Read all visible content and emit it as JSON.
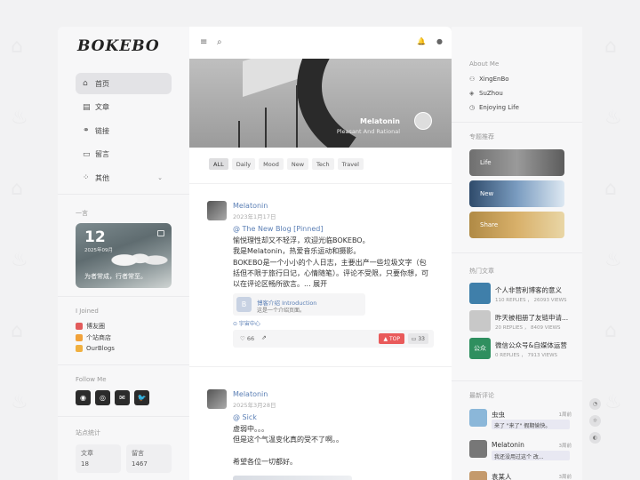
{
  "app": {
    "logo": "BOKEBO"
  },
  "nav": [
    {
      "icon": "home-icon",
      "glyph": "⌂",
      "label": "首页",
      "active": true
    },
    {
      "icon": "article-icon",
      "glyph": "▤",
      "label": "文章"
    },
    {
      "icon": "link-icon",
      "glyph": "⚭",
      "label": "链接"
    },
    {
      "icon": "message-icon",
      "glyph": "▭",
      "label": "留言"
    },
    {
      "icon": "grid-icon",
      "glyph": "⁘",
      "label": "其他",
      "chevron": "⌄"
    }
  ],
  "quote": {
    "section": "一言",
    "day": "12",
    "date": "2025年09月",
    "text": "为者常成，行者常至。"
  },
  "joined": {
    "section": "I Joined",
    "items": [
      {
        "label": "博友圈",
        "color": "#e25b5b"
      },
      {
        "label": "个站商店",
        "color": "#f1a23a"
      },
      {
        "label": "OurBlogs",
        "color": "#f0b040"
      }
    ]
  },
  "follow": {
    "section": "Follow Me",
    "icons": [
      {
        "name": "qq-icon",
        "glyph": "◉"
      },
      {
        "name": "wechat-icon",
        "glyph": "◎"
      },
      {
        "name": "mail-icon",
        "glyph": "✉"
      },
      {
        "name": "twitter-icon",
        "glyph": "🐦"
      }
    ]
  },
  "site_stats": {
    "section": "站点统计",
    "items": [
      {
        "label": "文章",
        "value": "18"
      },
      {
        "label": "留言",
        "value": "1467"
      }
    ]
  },
  "topbar": {
    "menu": "≡",
    "search": "⌕",
    "bell": "🔔",
    "user": "●"
  },
  "banner": {
    "title": "Melatonin",
    "subtitle": "Pleasant And Rational"
  },
  "tags": [
    {
      "label": "ALL",
      "active": true
    },
    {
      "label": "Daily"
    },
    {
      "label": "Mood"
    },
    {
      "label": "New"
    },
    {
      "label": "Tech"
    },
    {
      "label": "Travel"
    }
  ],
  "posts": [
    {
      "author": "Melatonin",
      "date": "2023年1月17日",
      "category": "@ The New Blog [Pinned]",
      "body": [
        "愉悦理性却又不轻浮，欢迎光临BOKEBO。",
        "我是Melatonin，热爱音乐运动和摄影。",
        "BOKEBO是一个小小的个人日志，主要出产一些垃圾文字（包",
        "括但不限于旅行日记，心情随笔）。评论不受限，只要你想，可",
        "以在评论区畅所欲言。... 展开"
      ],
      "link_card": {
        "title": "博客介绍 Introduction",
        "desc": "这是一个介绍页面。",
        "glyph": "B"
      },
      "location": "⊙ 宇宙中心",
      "likes": "♡ 66",
      "share": "⇗",
      "top_label": "▲ TOP",
      "comments": "▭ 33"
    },
    {
      "author": "Melatonin",
      "date": "2025年3月28日",
      "category": "@ Sick",
      "body": [
        "虚弱中。。。",
        "但是这个气温变化真的受不了啊。。",
        "",
        "希望各位一切都好。"
      ]
    }
  ],
  "about": {
    "section": "About Me",
    "items": [
      {
        "icon": "user-icon",
        "glyph": "⚇",
        "label": "XingEnBo"
      },
      {
        "icon": "location-icon",
        "glyph": "◈",
        "label": "SuZhou"
      },
      {
        "icon": "clock-icon",
        "glyph": "◷",
        "label": "Enjoying Life"
      }
    ]
  },
  "topics": {
    "section": "专题推荐",
    "items": [
      {
        "label": "Life",
        "bg": "linear-gradient(90deg,#6f6f6f,#9a9a9a,#5c5c5c)"
      },
      {
        "label": "New",
        "bg": "linear-gradient(90deg,#2f4b6b,#7a9cc0,#dde8f2)"
      },
      {
        "label": "Share",
        "bg": "linear-gradient(90deg,#b08a45,#d8b06a,#e9d6a6)"
      }
    ]
  },
  "hot": {
    "section": "热门文章",
    "items": [
      {
        "title": "个人非营利博客的意义",
        "meta": "110 REPLIES ， 26093 VIEWS",
        "bg": "#3f7faa"
      },
      {
        "title": "昨天被相册了友链申请...",
        "meta": "20 REPLIES ， 8409 VIEWS",
        "bg": "#c8c8c8"
      },
      {
        "title": "微信公众号&自媒体运营",
        "meta": "0 REPLIES ， 7913 VIEWS",
        "bg": "#2f8f5f",
        "thumb_text": "公众"
      }
    ]
  },
  "latest_comments": {
    "section": "最新评论",
    "items": [
      {
        "name": "虫虫",
        "when": "1周前",
        "text": "来了 \"来了\" 假期愉快。",
        "bg": "#8bb7d9"
      },
      {
        "name": "Melatonin",
        "when": "3周前",
        "text": "我还没用过这个 改...",
        "bg": "#777"
      },
      {
        "name": "袁某人",
        "when": "3周前",
        "text": "",
        "bg": "#c49a6c"
      }
    ]
  },
  "float_buttons": [
    {
      "name": "rss-icon",
      "glyph": "◔"
    },
    {
      "name": "sun-icon",
      "glyph": "☼"
    },
    {
      "name": "moon-icon",
      "glyph": "◐"
    }
  ]
}
